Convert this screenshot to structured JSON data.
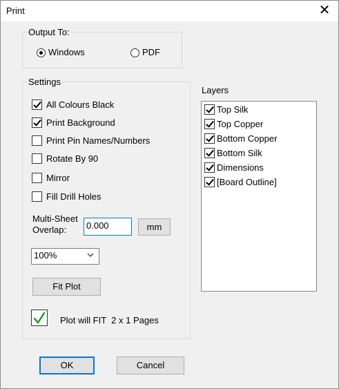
{
  "window": {
    "title": "Print",
    "close_glyph": "✕"
  },
  "output_to": {
    "legend": "Output To:",
    "options": [
      {
        "label": "Windows",
        "selected": true
      },
      {
        "label": "PDF",
        "selected": false
      }
    ]
  },
  "settings": {
    "legend": "Settings",
    "checkboxes": [
      {
        "label": "All Colours Black",
        "checked": true
      },
      {
        "label": "Print Background",
        "checked": true
      },
      {
        "label": "Print Pin Names/Numbers",
        "checked": false
      },
      {
        "label": "Rotate By 90",
        "checked": false
      },
      {
        "label": "Mirror",
        "checked": false
      },
      {
        "label": "Fill Drill Holes",
        "checked": false
      }
    ],
    "overlap_label_line1": "Multi-Sheet",
    "overlap_label_line2": "Overlap:",
    "overlap_value": "0.000",
    "units_label": "mm",
    "scale_value": "100%",
    "fit_plot_label": "Fit Plot",
    "status_text": "Plot will FIT  2 x 1 Pages"
  },
  "layers": {
    "label": "Layers",
    "items": [
      {
        "label": "Top Silk",
        "checked": true
      },
      {
        "label": "Top Copper",
        "checked": true
      },
      {
        "label": "Bottom Copper",
        "checked": true
      },
      {
        "label": "Bottom Silk",
        "checked": true
      },
      {
        "label": "Dimensions",
        "checked": true
      },
      {
        "label": "[Board Outline]",
        "checked": true
      }
    ]
  },
  "buttons": {
    "ok_label": "OK",
    "cancel_label": "Cancel"
  },
  "colors": {
    "accent": "#0078d7",
    "check_green": "#1a9a1a"
  }
}
